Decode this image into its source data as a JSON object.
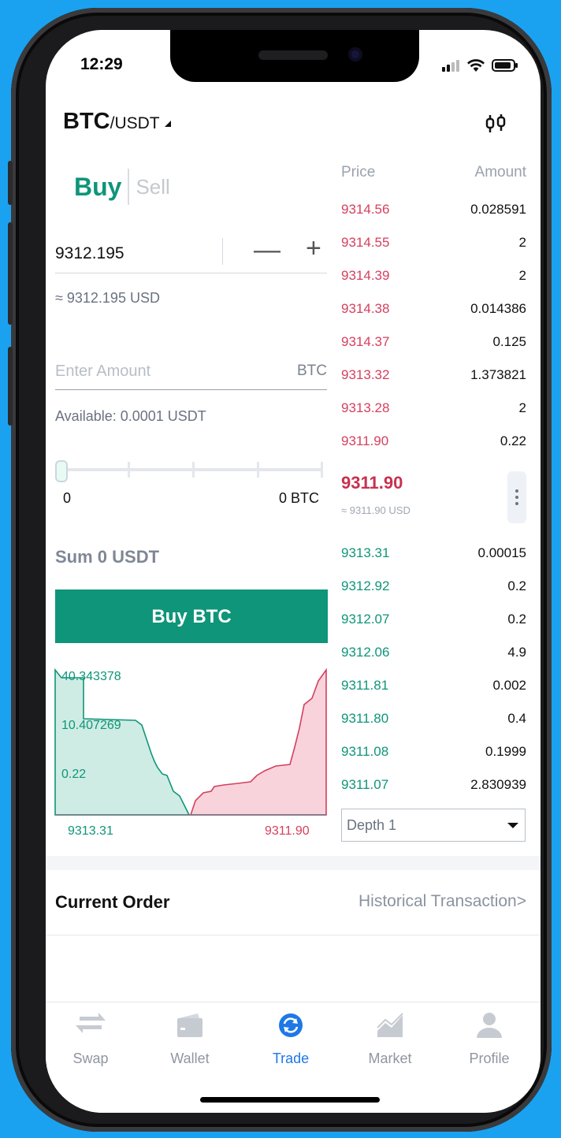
{
  "status_bar": {
    "time": "12:29"
  },
  "header": {
    "pair_base": "BTC",
    "pair_quote": "/USDT",
    "chart_icon": "candlestick-chart-icon"
  },
  "trade": {
    "tab_buy": "Buy",
    "tab_sell": "Sell",
    "price_value": "9312.195",
    "price_usd": "≈ 9312.195 USD",
    "minus": "—",
    "plus": "+",
    "amount_placeholder": "Enter Amount",
    "amount_unit": "BTC",
    "available": "Available: 0.0001 USDT",
    "slider_min": "0",
    "slider_max": "0 BTC",
    "slider_position": 0,
    "sum": "Sum 0 USDT",
    "buy_button": "Buy BTC"
  },
  "depth_chart": {
    "labels": [
      "40.343378",
      "10.407269",
      "0.22"
    ],
    "bid_label": "9313.31",
    "ask_label": "9311.90",
    "bid_color": "#0f9579",
    "ask_color": "#d4405e"
  },
  "order_book": {
    "header_price": "Price",
    "header_amount": "Amount",
    "asks": [
      {
        "price": "9314.56",
        "amount": "0.028591"
      },
      {
        "price": "9314.55",
        "amount": "2"
      },
      {
        "price": "9314.39",
        "amount": "2"
      },
      {
        "price": "9314.38",
        "amount": "0.014386"
      },
      {
        "price": "9314.37",
        "amount": "0.125"
      },
      {
        "price": "9313.32",
        "amount": "1.373821"
      },
      {
        "price": "9313.28",
        "amount": "2"
      },
      {
        "price": "9311.90",
        "amount": "0.22"
      }
    ],
    "last_price": "9311.90",
    "last_price_usd": "≈ 9311.90 USD",
    "bids": [
      {
        "price": "9313.31",
        "amount": "0.00015"
      },
      {
        "price": "9312.92",
        "amount": "0.2"
      },
      {
        "price": "9312.07",
        "amount": "0.2"
      },
      {
        "price": "9312.06",
        "amount": "4.9"
      },
      {
        "price": "9311.81",
        "amount": "0.002"
      },
      {
        "price": "9311.80",
        "amount": "0.4"
      },
      {
        "price": "9311.08",
        "amount": "0.1999"
      },
      {
        "price": "9311.07",
        "amount": "2.830939"
      }
    ],
    "depth_select": "Depth 1"
  },
  "orders": {
    "title": "Current Order",
    "history_link": "Historical Transaction>"
  },
  "tabbar": {
    "items": [
      {
        "label": "Swap",
        "icon": "swap-icon"
      },
      {
        "label": "Wallet",
        "icon": "wallet-icon"
      },
      {
        "label": "Trade",
        "icon": "trade-icon",
        "active": true
      },
      {
        "label": "Market",
        "icon": "market-icon"
      },
      {
        "label": "Profile",
        "icon": "profile-icon"
      }
    ]
  },
  "colors": {
    "accent": "#0f9579",
    "sell": "#d4405e",
    "active_tab": "#1e78e6",
    "background": "#1aa2f0"
  }
}
